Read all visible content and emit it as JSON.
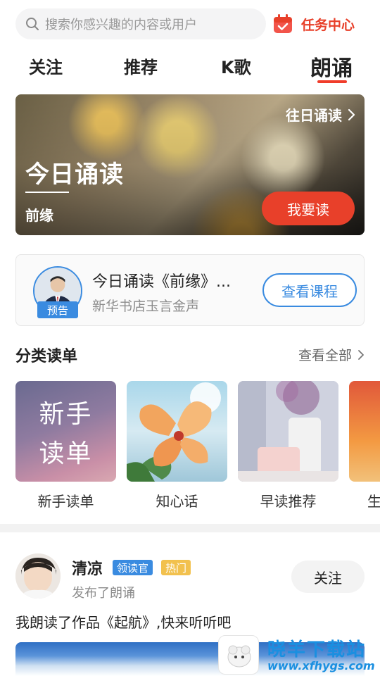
{
  "search": {
    "placeholder": "搜索你感兴趣的内容或用户"
  },
  "task_center": {
    "label": "任务中心"
  },
  "tabs": [
    {
      "label": "关注",
      "active": false
    },
    {
      "label": "推荐",
      "active": false
    },
    {
      "label": "K歌",
      "active": false
    },
    {
      "label": "朗诵",
      "active": true
    }
  ],
  "banner": {
    "past_link": "往日诵读",
    "title": "今日诵读",
    "subtitle": "前缘",
    "read_button": "我要读"
  },
  "preview": {
    "badge": "预告",
    "title": "今日诵读《前缘》...",
    "subtitle": "新华书店玉言金声",
    "course_button": "查看课程"
  },
  "categories": {
    "heading": "分类读单",
    "see_all": "查看全部",
    "items": [
      {
        "label": "新手读单",
        "thumb_lines": [
          "新手",
          "读单"
        ]
      },
      {
        "label": "知心话"
      },
      {
        "label": "早读推荐"
      },
      {
        "label": "生"
      }
    ]
  },
  "post": {
    "user": "清凉",
    "tag_reader": "领读官",
    "tag_hot": "热门",
    "action": "发布了朗诵",
    "follow_button": "关注",
    "text": "我朗读了作品《起航》,快来听听吧"
  },
  "watermark": {
    "name": "晓羊下载站",
    "url": "www.xfhygs.com"
  },
  "colors": {
    "accent": "#e8402a",
    "blue": "#3a8be0",
    "hot": "#f2c14e"
  }
}
